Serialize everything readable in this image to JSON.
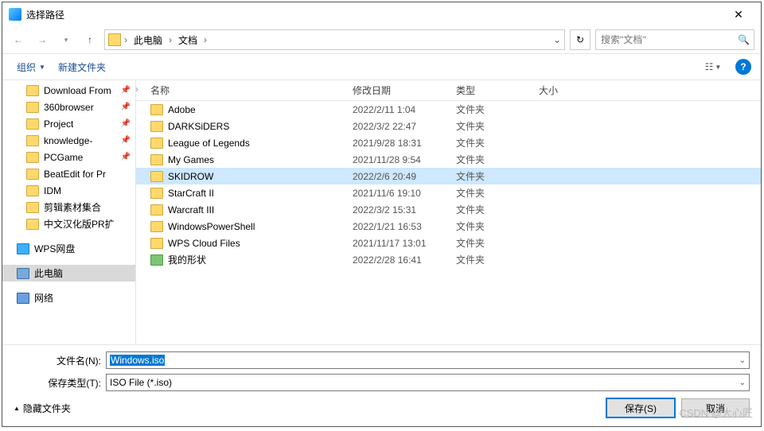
{
  "title": "选择路径",
  "breadcrumb": {
    "root": "此电脑",
    "folder": "文档"
  },
  "search": {
    "placeholder": "搜索\"文档\""
  },
  "toolbar": {
    "organize": "组织",
    "newfolder": "新建文件夹"
  },
  "columns": {
    "name": "名称",
    "date": "修改日期",
    "type": "类型",
    "size": "大小"
  },
  "sidebar": [
    {
      "label": "Download From",
      "pinned": true
    },
    {
      "label": "360browser",
      "pinned": true
    },
    {
      "label": "Project",
      "pinned": true
    },
    {
      "label": "knowledge-",
      "pinned": true
    },
    {
      "label": "PCGame",
      "pinned": true
    },
    {
      "label": "BeatEdit for Pr"
    },
    {
      "label": "IDM"
    },
    {
      "label": "剪辑素材集合"
    },
    {
      "label": "中文汉化版PR扩"
    }
  ],
  "sidebar_special": [
    {
      "label": "WPS网盘",
      "kind": "wps"
    },
    {
      "label": "此电脑",
      "kind": "pc",
      "selected": true
    },
    {
      "label": "网络",
      "kind": "net"
    }
  ],
  "files": [
    {
      "name": "Adobe",
      "date": "2022/2/11 1:04",
      "type": "文件夹"
    },
    {
      "name": "DARKSiDERS",
      "date": "2022/3/2 22:47",
      "type": "文件夹"
    },
    {
      "name": "League of Legends",
      "date": "2021/9/28 18:31",
      "type": "文件夹"
    },
    {
      "name": "My Games",
      "date": "2021/11/28 9:54",
      "type": "文件夹"
    },
    {
      "name": "SKIDROW",
      "date": "2022/2/6 20:49",
      "type": "文件夹",
      "selected": true
    },
    {
      "name": "StarCraft II",
      "date": "2021/11/6 19:10",
      "type": "文件夹"
    },
    {
      "name": "Warcraft III",
      "date": "2022/3/2 15:31",
      "type": "文件夹"
    },
    {
      "name": "WindowsPowerShell",
      "date": "2022/1/21 16:53",
      "type": "文件夹"
    },
    {
      "name": "WPS Cloud Files",
      "date": "2021/11/17 13:01",
      "type": "文件夹"
    },
    {
      "name": "我的形状",
      "date": "2022/2/28 16:41",
      "type": "文件夹",
      "special": true
    }
  ],
  "form": {
    "filename_label": "文件名(N):",
    "filename_value": "Windows.iso",
    "filetype_label": "保存类型(T):",
    "filetype_value": "ISO File (*.iso)"
  },
  "actions": {
    "hide": "隐藏文件夹",
    "save": "保存(S)",
    "cancel": "取消"
  },
  "watermark": "CSDN @大心匠"
}
